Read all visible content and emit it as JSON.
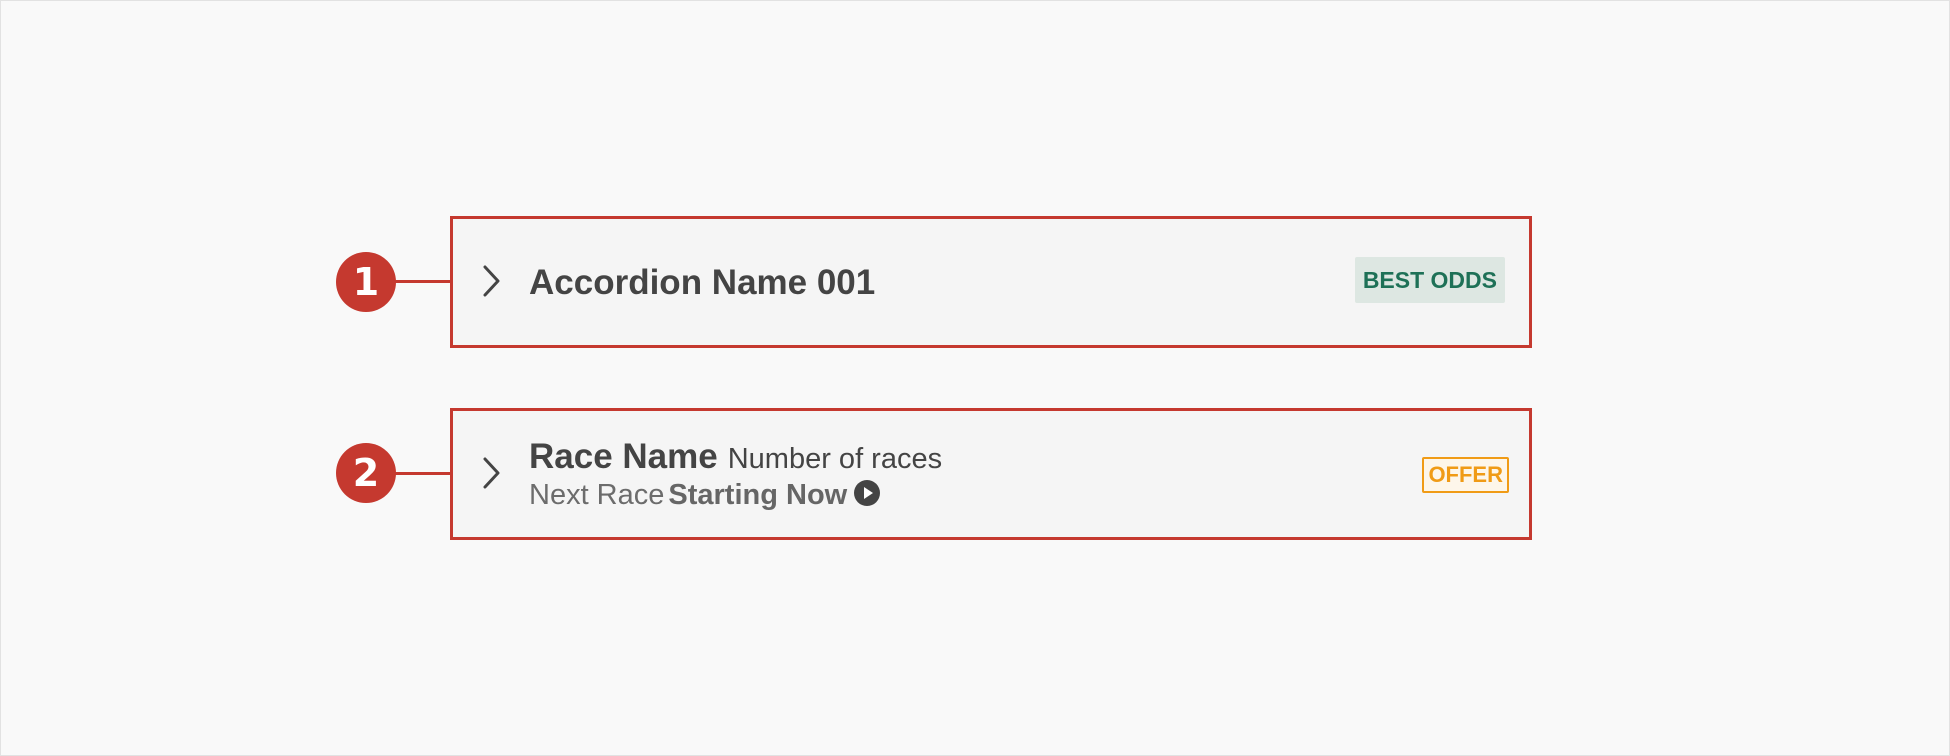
{
  "callouts": [
    {
      "number": "1"
    },
    {
      "number": "2"
    }
  ],
  "accordion_1": {
    "title": "Accordion Name 001",
    "tag": "BEST ODDS",
    "icon": "chevron-right-icon"
  },
  "accordion_2": {
    "race_name": "Race Name",
    "race_count": "Number of races",
    "next_race_label": "Next Race",
    "next_race_status": "Starting Now",
    "tag": "OFFER",
    "icon": "chevron-right-icon",
    "status_icon": "play-circle-icon"
  },
  "colors": {
    "callout": "#c5392f",
    "best_odds_text": "#1e7157",
    "best_odds_bg": "#dde7e2",
    "offer": "#f09b16",
    "title_text": "#444444"
  }
}
